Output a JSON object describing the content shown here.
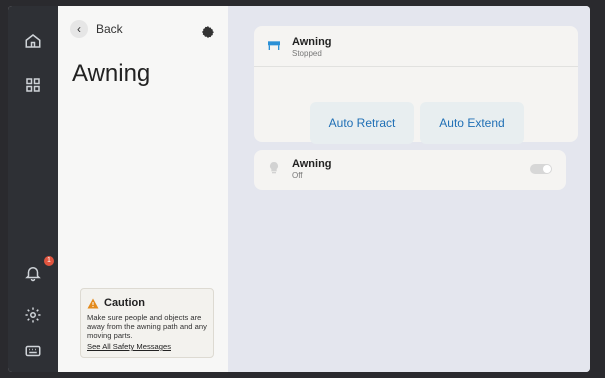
{
  "nav": {
    "home_icon": "home-icon",
    "grid_icon": "grid-icon",
    "bell_icon": "bell-icon",
    "notification_count": "1",
    "settings_icon": "settings-icon",
    "keyboard_icon": "keyboard-icon"
  },
  "left_panel": {
    "back_label": "Back",
    "title": "Awning",
    "settings_icon": "gear-icon",
    "caution": {
      "title": "Caution",
      "text": "Make sure people and objects are away from the awning path and any moving parts.",
      "link": "See All Safety Messages",
      "icon": "warning-icon",
      "accent": "#e38a1b"
    }
  },
  "main": {
    "awning_control": {
      "title": "Awning",
      "status": "Stopped",
      "icon": "awning-icon",
      "buttons": {
        "retract": "Auto Retract",
        "extend": "Auto Extend"
      }
    },
    "awning_light": {
      "title": "Awning",
      "status": "Off",
      "icon": "light-bulb-icon",
      "toggle_on": false
    }
  },
  "colors": {
    "accent": "#1f6fb5",
    "badge": "#e2553f",
    "rail": "#2e3035"
  }
}
